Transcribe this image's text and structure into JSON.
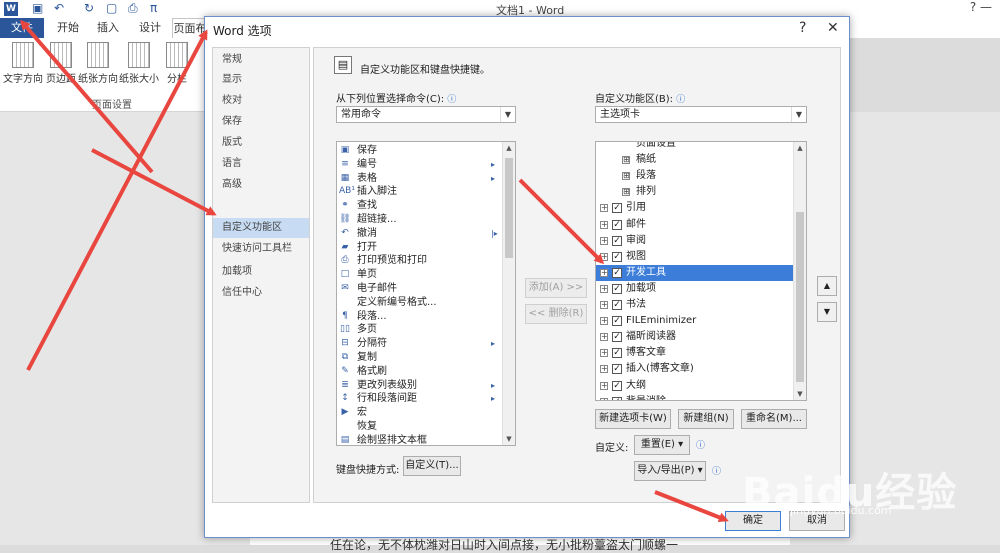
{
  "word": {
    "doc_title": "文档1 - Word",
    "tb_right": "?  —",
    "tabs": [
      "文件",
      "开始",
      "插入",
      "设计",
      "页面布"
    ],
    "ribbon_buttons": [
      "文字方向",
      "页边距",
      "纸张方向",
      "纸张大小",
      "分栏"
    ],
    "group_label": "页面设置",
    "doc_bottom_text": "任在论，无不体枕潍对日山时入间点接，无小批粉薹盗太门顺螺一"
  },
  "dialog": {
    "title": "Word 选项",
    "help": "?",
    "close": "✕",
    "nav_items": [
      "常规",
      "显示",
      "校对",
      "保存",
      "版式",
      "语言",
      "高级",
      "自定义功能区",
      "快速访问工具栏",
      "加载项",
      "信任中心"
    ],
    "header": "自定义功能区和键盘快捷键。",
    "left_label": "从下列位置选择命令(C):",
    "left_combo": "常用命令",
    "right_label": "自定义功能区(B):",
    "right_combo": "主选项卡",
    "commands": [
      {
        "icon": "▣",
        "label": "保存",
        "sub": ""
      },
      {
        "icon": "≡",
        "label": "编号",
        "sub": "▸"
      },
      {
        "icon": "▦",
        "label": "表格",
        "sub": "▸"
      },
      {
        "icon": "AB¹",
        "label": "插入脚注",
        "sub": ""
      },
      {
        "icon": "⚭",
        "label": "查找",
        "sub": ""
      },
      {
        "icon": "⛓",
        "label": "超链接...",
        "sub": ""
      },
      {
        "icon": "↶",
        "label": "撤消",
        "sub": "|▸"
      },
      {
        "icon": "▰",
        "label": "打开",
        "sub": ""
      },
      {
        "icon": "⎙",
        "label": "打印预览和打印",
        "sub": ""
      },
      {
        "icon": "□",
        "label": "单页",
        "sub": ""
      },
      {
        "icon": "✉",
        "label": "电子邮件",
        "sub": ""
      },
      {
        "icon": "",
        "label": "定义新编号格式...",
        "sub": ""
      },
      {
        "icon": "¶",
        "label": "段落...",
        "sub": ""
      },
      {
        "icon": "▯▯",
        "label": "多页",
        "sub": ""
      },
      {
        "icon": "⊟",
        "label": "分隔符",
        "sub": "▸"
      },
      {
        "icon": "⧉",
        "label": "复制",
        "sub": ""
      },
      {
        "icon": "✎",
        "label": "格式刷",
        "sub": ""
      },
      {
        "icon": "≣",
        "label": "更改列表级别",
        "sub": "▸"
      },
      {
        "icon": "↕",
        "label": "行和段落间距",
        "sub": "▸"
      },
      {
        "icon": "▶",
        "label": "宏",
        "sub": ""
      },
      {
        "icon": "",
        "label": "恢复",
        "sub": ""
      },
      {
        "icon": "▤",
        "label": "绘制竖排文本框",
        "sub": ""
      }
    ],
    "tree": [
      {
        "label": "页面设置",
        "level": 2,
        "exp": "",
        "checked": false,
        "selected": false
      },
      {
        "label": "稿纸",
        "level": 2,
        "exp": "⊞",
        "checked": false,
        "selected": false
      },
      {
        "label": "段落",
        "level": 2,
        "exp": "⊞",
        "checked": false,
        "selected": false
      },
      {
        "label": "排列",
        "level": 2,
        "exp": "⊞",
        "checked": false,
        "selected": false
      },
      {
        "label": "引用",
        "level": 1,
        "exp": "+",
        "checked": true,
        "selected": false
      },
      {
        "label": "邮件",
        "level": 1,
        "exp": "+",
        "checked": true,
        "selected": false
      },
      {
        "label": "审阅",
        "level": 1,
        "exp": "+",
        "checked": true,
        "selected": false
      },
      {
        "label": "视图",
        "level": 1,
        "exp": "+",
        "checked": true,
        "selected": false
      },
      {
        "label": "开发工具",
        "level": 1,
        "exp": "+",
        "checked": true,
        "selected": true
      },
      {
        "label": "加载项",
        "level": 1,
        "exp": "+",
        "checked": true,
        "selected": false
      },
      {
        "label": "书法",
        "level": 1,
        "exp": "+",
        "checked": true,
        "selected": false
      },
      {
        "label": "FILEminimizer",
        "level": 1,
        "exp": "+",
        "checked": true,
        "selected": false
      },
      {
        "label": "福昕阅读器",
        "level": 1,
        "exp": "+",
        "checked": true,
        "selected": false
      },
      {
        "label": "博客文章",
        "level": 1,
        "exp": "+",
        "checked": true,
        "selected": false
      },
      {
        "label": "插入(博客文章)",
        "level": 1,
        "exp": "+",
        "checked": true,
        "selected": false
      },
      {
        "label": "大纲",
        "level": 1,
        "exp": "+",
        "checked": true,
        "selected": false
      },
      {
        "label": "背景消除",
        "level": 1,
        "exp": "+",
        "checked": true,
        "selected": false
      }
    ],
    "add_button": "添加(A) >>",
    "remove_button": "<< 删除(R)",
    "new_tab_button": "新建选项卡(W)",
    "new_group_button": "新建组(N)",
    "rename_button": "重命名(M)...",
    "customize_label": "自定义:",
    "reset_button": "重置(E) ▾",
    "import_export_button": "导入/导出(P) ▾",
    "keyboard_label": "键盘快捷方式:",
    "keyboard_button": "自定义(T)...",
    "ok_button": "确定",
    "cancel_button": "取消",
    "move_up": "▲",
    "move_down": "▼"
  },
  "watermark": {
    "text": "Baidu经验",
    "sub": "jingyan.baidu.com"
  },
  "colors": {
    "arrow": "#e8463f",
    "selection": "#3b7dd8",
    "accent": "#2b579a"
  }
}
